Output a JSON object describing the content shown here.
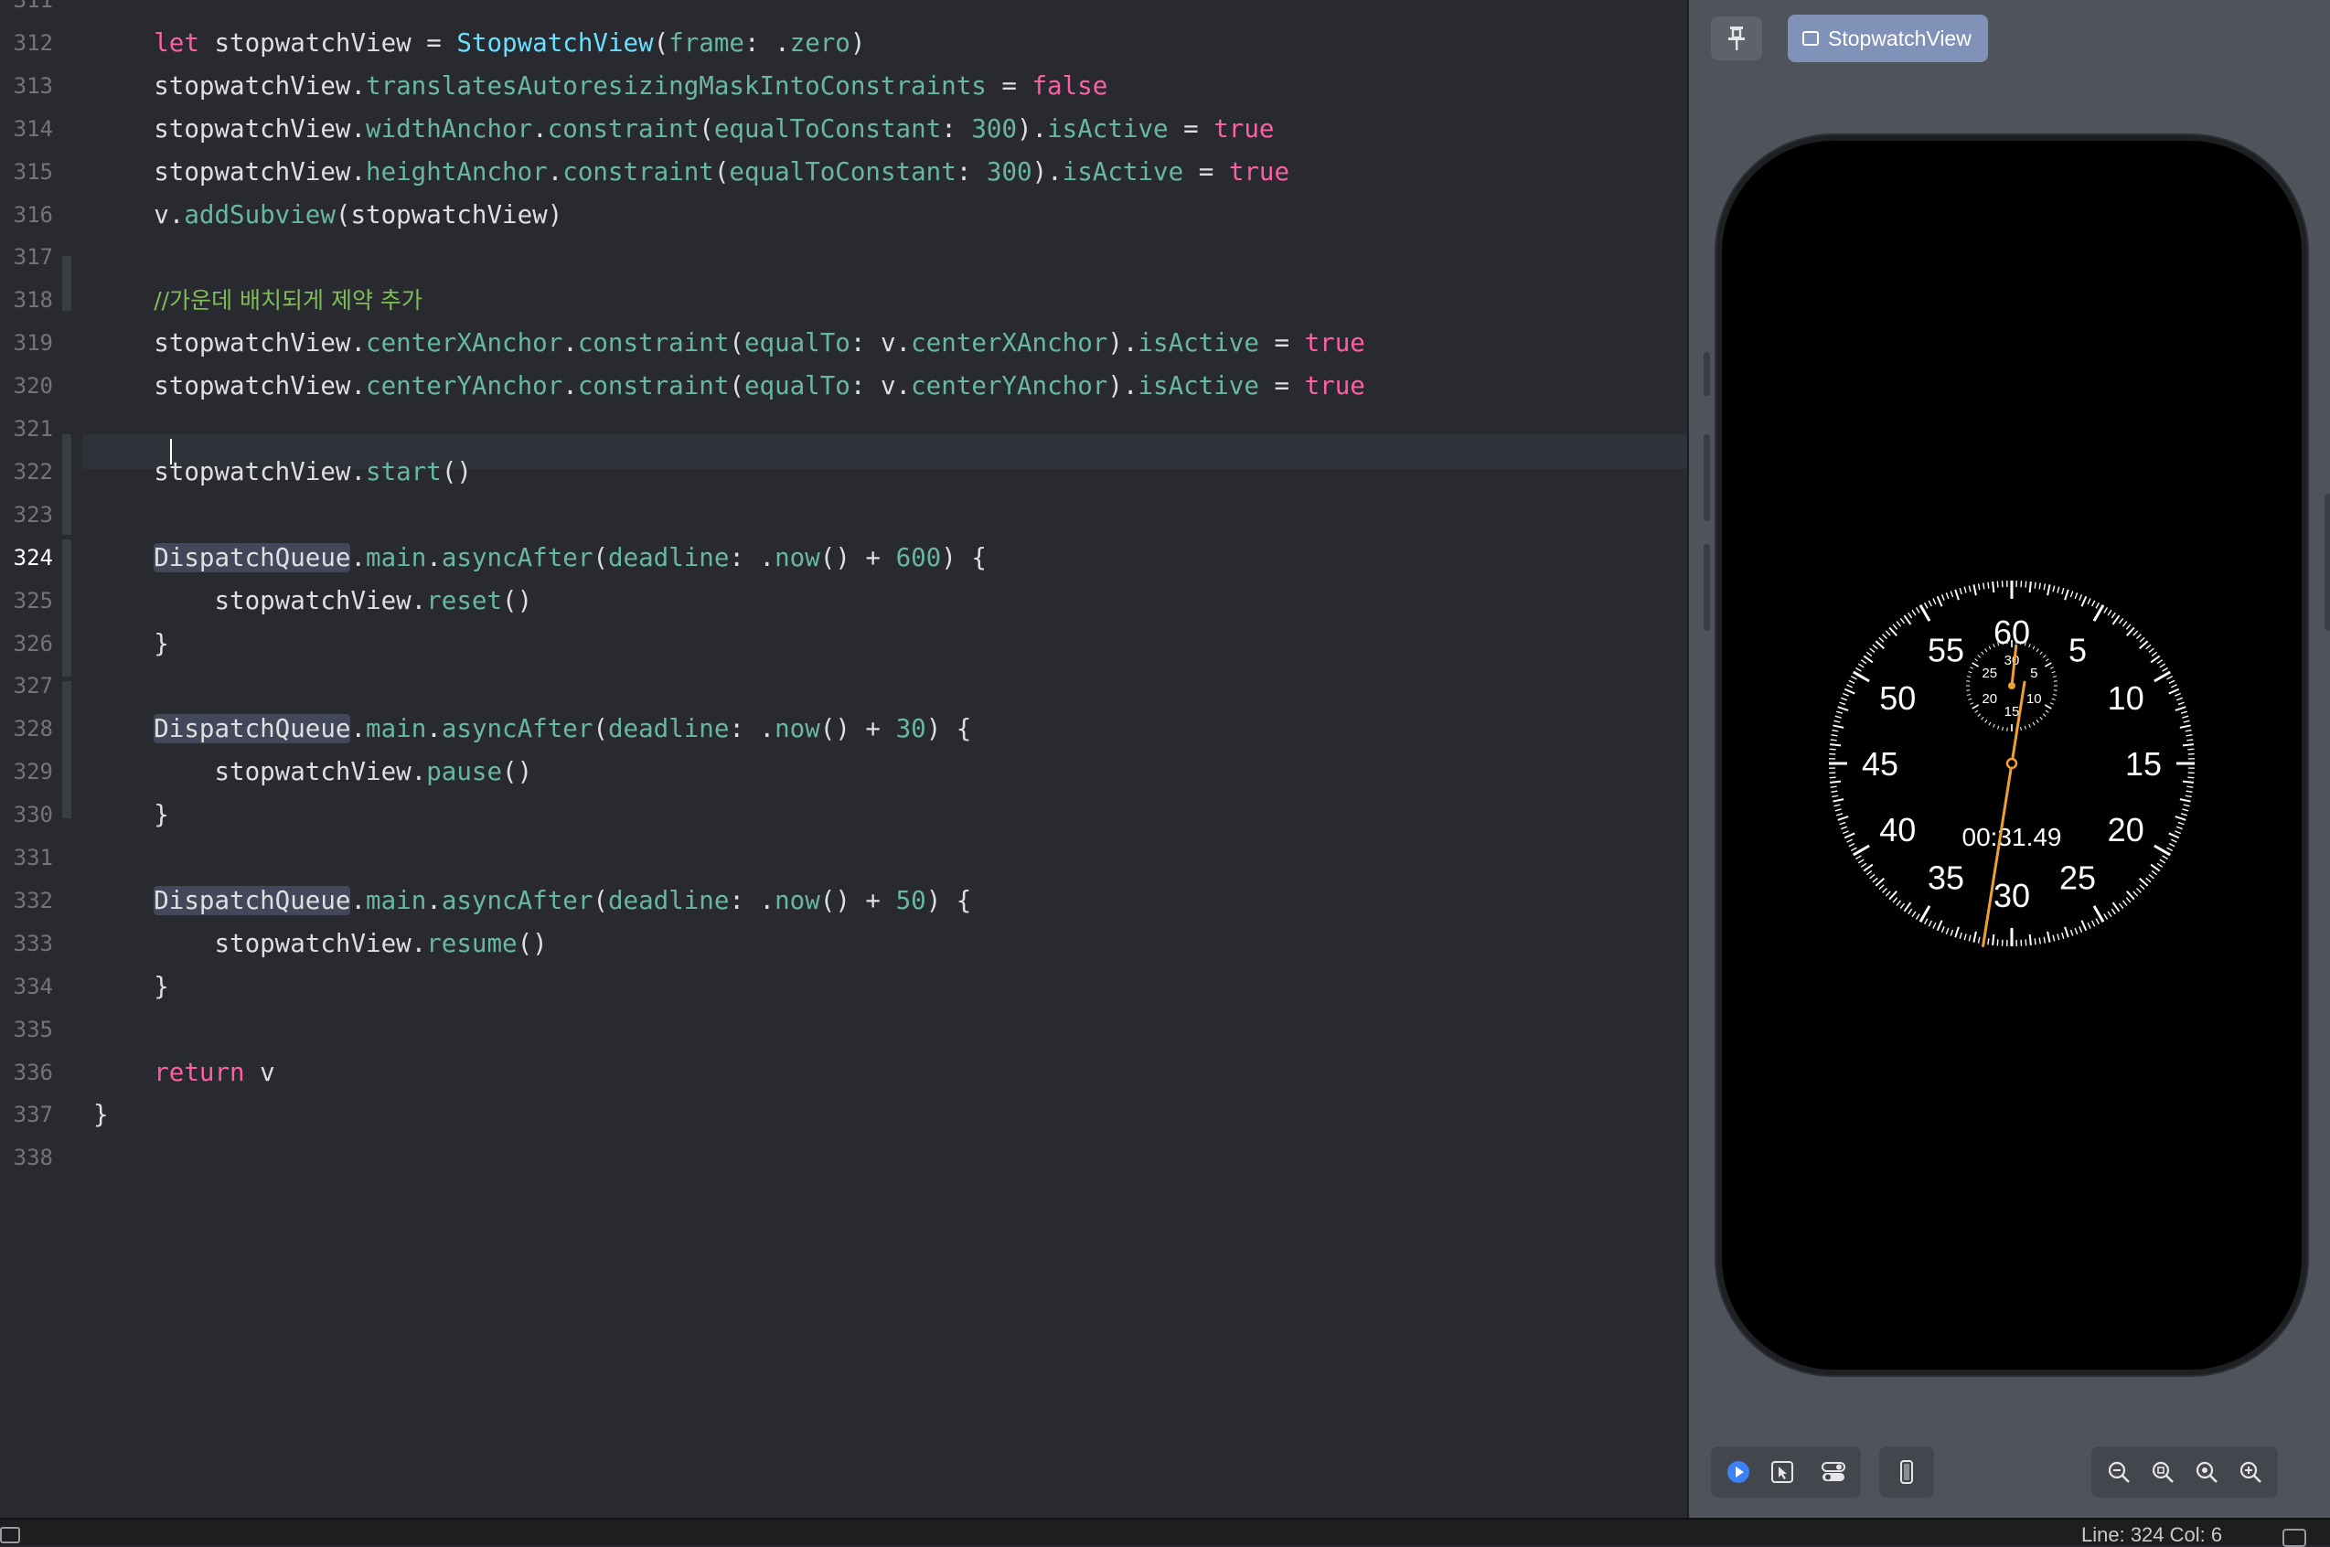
{
  "editor": {
    "active_line": "324",
    "lines": [
      {
        "n": "311",
        "tokens": []
      },
      {
        "n": "312",
        "tokens": [
          {
            "t": "    ",
            "c": "pl"
          },
          {
            "t": "let",
            "c": "kw"
          },
          {
            "t": " stopwatchView = ",
            "c": "pl"
          },
          {
            "t": "StopwatchView",
            "c": "ty"
          },
          {
            "t": "(",
            "c": "pl"
          },
          {
            "t": "frame",
            "c": "pr"
          },
          {
            "t": ": .",
            "c": "pl"
          },
          {
            "t": "zero",
            "c": "pr"
          },
          {
            "t": ")",
            "c": "pl"
          }
        ]
      },
      {
        "n": "313",
        "tokens": [
          {
            "t": "    stopwatchView.",
            "c": "pl"
          },
          {
            "t": "translatesAutoresizingMaskIntoConstraints",
            "c": "pr"
          },
          {
            "t": " = ",
            "c": "pl"
          },
          {
            "t": "false",
            "c": "kw"
          }
        ]
      },
      {
        "n": "314",
        "tokens": [
          {
            "t": "    stopwatchView.",
            "c": "pl"
          },
          {
            "t": "widthAnchor",
            "c": "pr"
          },
          {
            "t": ".",
            "c": "pl"
          },
          {
            "t": "constraint",
            "c": "pr"
          },
          {
            "t": "(",
            "c": "pl"
          },
          {
            "t": "equalToConstant",
            "c": "pr"
          },
          {
            "t": ": ",
            "c": "pl"
          },
          {
            "t": "300",
            "c": "pr"
          },
          {
            "t": ").",
            "c": "pl"
          },
          {
            "t": "isActive",
            "c": "pr"
          },
          {
            "t": " = ",
            "c": "pl"
          },
          {
            "t": "true",
            "c": "kw"
          }
        ]
      },
      {
        "n": "315",
        "tokens": [
          {
            "t": "    stopwatchView.",
            "c": "pl"
          },
          {
            "t": "heightAnchor",
            "c": "pr"
          },
          {
            "t": ".",
            "c": "pl"
          },
          {
            "t": "constraint",
            "c": "pr"
          },
          {
            "t": "(",
            "c": "pl"
          },
          {
            "t": "equalToConstant",
            "c": "pr"
          },
          {
            "t": ": ",
            "c": "pl"
          },
          {
            "t": "300",
            "c": "pr"
          },
          {
            "t": ").",
            "c": "pl"
          },
          {
            "t": "isActive",
            "c": "pr"
          },
          {
            "t": " = ",
            "c": "pl"
          },
          {
            "t": "true",
            "c": "kw"
          }
        ]
      },
      {
        "n": "316",
        "tokens": [
          {
            "t": "    v.",
            "c": "pl"
          },
          {
            "t": "addSubview",
            "c": "pr"
          },
          {
            "t": "(stopwatchView)",
            "c": "pl"
          }
        ]
      },
      {
        "n": "317",
        "tokens": []
      },
      {
        "n": "318",
        "tokens": [
          {
            "t": "    ",
            "c": "pl"
          },
          {
            "t": "//가운데 배치되게 제약 추가",
            "c": "cm"
          }
        ]
      },
      {
        "n": "319",
        "tokens": [
          {
            "t": "    stopwatchView.",
            "c": "pl"
          },
          {
            "t": "centerXAnchor",
            "c": "pr"
          },
          {
            "t": ".",
            "c": "pl"
          },
          {
            "t": "constraint",
            "c": "pr"
          },
          {
            "t": "(",
            "c": "pl"
          },
          {
            "t": "equalTo",
            "c": "pr"
          },
          {
            "t": ": v.",
            "c": "pl"
          },
          {
            "t": "centerXAnchor",
            "c": "pr"
          },
          {
            "t": ").",
            "c": "pl"
          },
          {
            "t": "isActive",
            "c": "pr"
          },
          {
            "t": " = ",
            "c": "pl"
          },
          {
            "t": "true",
            "c": "kw"
          }
        ]
      },
      {
        "n": "320",
        "tokens": [
          {
            "t": "    stopwatchView.",
            "c": "pl"
          },
          {
            "t": "centerYAnchor",
            "c": "pr"
          },
          {
            "t": ".",
            "c": "pl"
          },
          {
            "t": "constraint",
            "c": "pr"
          },
          {
            "t": "(",
            "c": "pl"
          },
          {
            "t": "equalTo",
            "c": "pr"
          },
          {
            "t": ": v.",
            "c": "pl"
          },
          {
            "t": "centerYAnchor",
            "c": "pr"
          },
          {
            "t": ").",
            "c": "pl"
          },
          {
            "t": "isActive",
            "c": "pr"
          },
          {
            "t": " = ",
            "c": "pl"
          },
          {
            "t": "true",
            "c": "kw"
          }
        ]
      },
      {
        "n": "321",
        "tokens": []
      },
      {
        "n": "322",
        "tokens": [
          {
            "t": "    stopwatchView.",
            "c": "pl"
          },
          {
            "t": "start",
            "c": "pr"
          },
          {
            "t": "()",
            "c": "pl"
          }
        ]
      },
      {
        "n": "323",
        "tokens": []
      },
      {
        "n": "324",
        "tokens": [
          {
            "t": "    ",
            "c": "pl"
          },
          {
            "t": "DispatchQueue",
            "c": "hl"
          },
          {
            "t": ".",
            "c": "pl"
          },
          {
            "t": "main",
            "c": "pr"
          },
          {
            "t": ".",
            "c": "pl"
          },
          {
            "t": "asyncAfter",
            "c": "pr"
          },
          {
            "t": "(",
            "c": "pl"
          },
          {
            "t": "deadline",
            "c": "pr"
          },
          {
            "t": ": .",
            "c": "pl"
          },
          {
            "t": "now",
            "c": "pr"
          },
          {
            "t": "() + ",
            "c": "pl"
          },
          {
            "t": "600",
            "c": "pr"
          },
          {
            "t": ") {",
            "c": "pl"
          }
        ]
      },
      {
        "n": "325",
        "tokens": [
          {
            "t": "        stopwatchView.",
            "c": "pl"
          },
          {
            "t": "reset",
            "c": "pr"
          },
          {
            "t": "()",
            "c": "pl"
          }
        ]
      },
      {
        "n": "326",
        "tokens": [
          {
            "t": "    }",
            "c": "pl"
          }
        ]
      },
      {
        "n": "327",
        "tokens": []
      },
      {
        "n": "328",
        "tokens": [
          {
            "t": "    ",
            "c": "pl"
          },
          {
            "t": "DispatchQueue",
            "c": "hl"
          },
          {
            "t": ".",
            "c": "pl"
          },
          {
            "t": "main",
            "c": "pr"
          },
          {
            "t": ".",
            "c": "pl"
          },
          {
            "t": "asyncAfter",
            "c": "pr"
          },
          {
            "t": "(",
            "c": "pl"
          },
          {
            "t": "deadline",
            "c": "pr"
          },
          {
            "t": ": .",
            "c": "pl"
          },
          {
            "t": "now",
            "c": "pr"
          },
          {
            "t": "() + ",
            "c": "pl"
          },
          {
            "t": "30",
            "c": "pr"
          },
          {
            "t": ") {",
            "c": "pl"
          }
        ]
      },
      {
        "n": "329",
        "tokens": [
          {
            "t": "        stopwatchView.",
            "c": "pl"
          },
          {
            "t": "pause",
            "c": "pr"
          },
          {
            "t": "()",
            "c": "pl"
          }
        ]
      },
      {
        "n": "330",
        "tokens": [
          {
            "t": "    }",
            "c": "pl"
          }
        ]
      },
      {
        "n": "331",
        "tokens": []
      },
      {
        "n": "332",
        "tokens": [
          {
            "t": "    ",
            "c": "pl"
          },
          {
            "t": "DispatchQueue",
            "c": "hl"
          },
          {
            "t": ".",
            "c": "pl"
          },
          {
            "t": "main",
            "c": "pr"
          },
          {
            "t": ".",
            "c": "pl"
          },
          {
            "t": "asyncAfter",
            "c": "pr"
          },
          {
            "t": "(",
            "c": "pl"
          },
          {
            "t": "deadline",
            "c": "pr"
          },
          {
            "t": ": .",
            "c": "pl"
          },
          {
            "t": "now",
            "c": "pr"
          },
          {
            "t": "() + ",
            "c": "pl"
          },
          {
            "t": "50",
            "c": "pr"
          },
          {
            "t": ") {",
            "c": "pl"
          }
        ]
      },
      {
        "n": "333",
        "tokens": [
          {
            "t": "        stopwatchView.",
            "c": "pl"
          },
          {
            "t": "resume",
            "c": "pr"
          },
          {
            "t": "()",
            "c": "pl"
          }
        ]
      },
      {
        "n": "334",
        "tokens": [
          {
            "t": "    }",
            "c": "pl"
          }
        ]
      },
      {
        "n": "335",
        "tokens": []
      },
      {
        "n": "336",
        "tokens": [
          {
            "t": "    ",
            "c": "pl"
          },
          {
            "t": "return",
            "c": "kw"
          },
          {
            "t": " v",
            "c": "pl"
          }
        ]
      },
      {
        "n": "337",
        "tokens": [
          {
            "t": "}",
            "c": "pl"
          }
        ]
      },
      {
        "n": "338",
        "tokens": []
      }
    ]
  },
  "preview": {
    "chip_label": "StopwatchView",
    "pin_icon": "pin-icon",
    "stopwatch": {
      "time_readout": "00:31.49",
      "main_labels": [
        "60",
        "5",
        "10",
        "15",
        "20",
        "25",
        "30",
        "35",
        "40",
        "45",
        "50",
        "55"
      ],
      "sub_labels": [
        "30",
        "5",
        "10",
        "15",
        "20",
        "25"
      ],
      "main_hand_seconds": 31.49,
      "sub_hand_minutes": 0.52,
      "hand_color": "#f0a030"
    },
    "toolbar": {
      "left": [
        "live-preview-icon",
        "selectable-icon",
        "variants-icon"
      ],
      "middle": [
        "device-settings-icon"
      ],
      "device": [
        "device-icon"
      ],
      "zoom": [
        "zoom-out-icon",
        "zoom-fit-icon",
        "zoom-100-icon",
        "zoom-in-icon"
      ]
    }
  },
  "status": {
    "cursor_position": "Line: 324  Col: 6"
  },
  "colors": {
    "keyword": "#fc5fa3",
    "type": "#6bdfff",
    "property": "#67b7a4",
    "comment": "#7ebd5a",
    "editor_bg": "#292a30"
  }
}
